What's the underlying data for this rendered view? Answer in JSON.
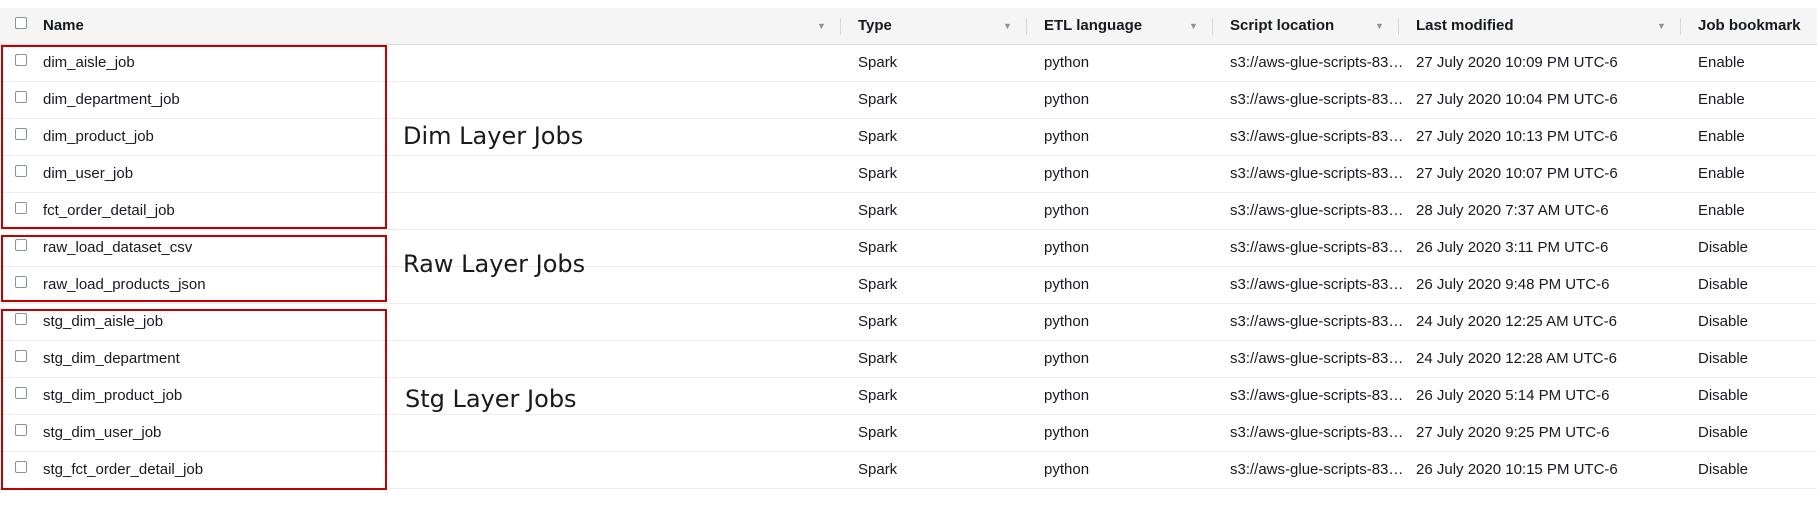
{
  "columns": {
    "name": "Name",
    "type": "Type",
    "etl_language": "ETL language",
    "script_location": "Script location",
    "last_modified": "Last modified",
    "job_bookmark": "Job bookmark"
  },
  "rows": [
    {
      "name": "dim_aisle_job",
      "type": "Spark",
      "etl_language": "python",
      "script_location": "s3://aws-glue-scripts-83…",
      "last_modified": "27 July 2020 10:09 PM UTC-6",
      "job_bookmark": "Enable"
    },
    {
      "name": "dim_department_job",
      "type": "Spark",
      "etl_language": "python",
      "script_location": "s3://aws-glue-scripts-83…",
      "last_modified": "27 July 2020 10:04 PM UTC-6",
      "job_bookmark": "Enable"
    },
    {
      "name": "dim_product_job",
      "type": "Spark",
      "etl_language": "python",
      "script_location": "s3://aws-glue-scripts-83…",
      "last_modified": "27 July 2020 10:13 PM UTC-6",
      "job_bookmark": "Enable"
    },
    {
      "name": "dim_user_job",
      "type": "Spark",
      "etl_language": "python",
      "script_location": "s3://aws-glue-scripts-83…",
      "last_modified": "27 July 2020 10:07 PM UTC-6",
      "job_bookmark": "Enable"
    },
    {
      "name": "fct_order_detail_job",
      "type": "Spark",
      "etl_language": "python",
      "script_location": "s3://aws-glue-scripts-83…",
      "last_modified": "28 July 2020 7:37 AM UTC-6",
      "job_bookmark": "Enable"
    },
    {
      "name": "raw_load_dataset_csv",
      "type": "Spark",
      "etl_language": "python",
      "script_location": "s3://aws-glue-scripts-83…",
      "last_modified": "26 July 2020 3:11 PM UTC-6",
      "job_bookmark": "Disable"
    },
    {
      "name": "raw_load_products_json",
      "type": "Spark",
      "etl_language": "python",
      "script_location": "s3://aws-glue-scripts-83…",
      "last_modified": "26 July 2020 9:48 PM UTC-6",
      "job_bookmark": "Disable"
    },
    {
      "name": "stg_dim_aisle_job",
      "type": "Spark",
      "etl_language": "python",
      "script_location": "s3://aws-glue-scripts-83…",
      "last_modified": "24 July 2020 12:25 AM UTC-6",
      "job_bookmark": "Disable"
    },
    {
      "name": "stg_dim_department",
      "type": "Spark",
      "etl_language": "python",
      "script_location": "s3://aws-glue-scripts-83…",
      "last_modified": "24 July 2020 12:28 AM UTC-6",
      "job_bookmark": "Disable"
    },
    {
      "name": "stg_dim_product_job",
      "type": "Spark",
      "etl_language": "python",
      "script_location": "s3://aws-glue-scripts-83…",
      "last_modified": "26 July 2020 5:14 PM UTC-6",
      "job_bookmark": "Disable"
    },
    {
      "name": "stg_dim_user_job",
      "type": "Spark",
      "etl_language": "python",
      "script_location": "s3://aws-glue-scripts-83…",
      "last_modified": "27 July 2020 9:25 PM UTC-6",
      "job_bookmark": "Disable"
    },
    {
      "name": "stg_fct_order_detail_job",
      "type": "Spark",
      "etl_language": "python",
      "script_location": "s3://aws-glue-scripts-83…",
      "last_modified": "26 July 2020 10:15 PM UTC-6",
      "job_bookmark": "Disable"
    }
  ],
  "annotations": [
    {
      "label": "Dim Layer Jobs"
    },
    {
      "label": "Raw Layer Jobs"
    },
    {
      "label": "Stg Layer Jobs"
    }
  ],
  "colors": {
    "annotation_border": "#c00000",
    "header_bg": "#f5f5f5",
    "row_divider": "#eaeded"
  },
  "icons": {
    "sort": "caret-down-icon",
    "select": "checkbox"
  }
}
